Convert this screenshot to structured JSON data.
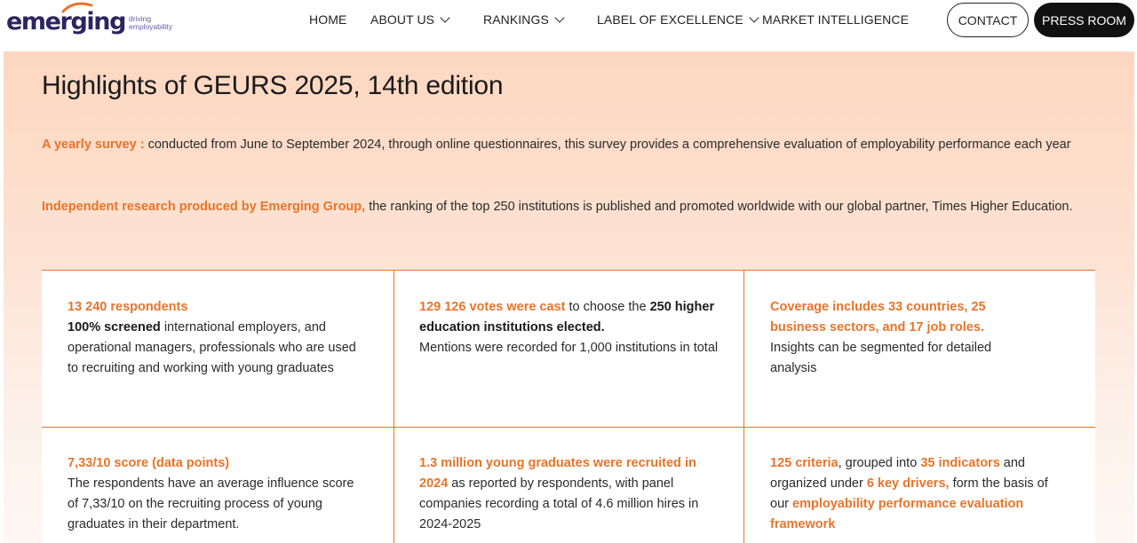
{
  "header": {
    "logo": {
      "word": "emerging",
      "tagline_line1": "driving",
      "tagline_line2": "employability"
    },
    "nav": {
      "home": "HOME",
      "about": "ABOUT US",
      "rankings": "RANKINGS",
      "label": "LABEL OF EXCELLENCE",
      "market": "MARKET INTELLIGENCE"
    },
    "contact": "CONTACT",
    "press": "PRESS ROOM"
  },
  "main": {
    "title": "Highlights of GEURS 2025, 14th edition",
    "para1": {
      "highlight": "A yearly survey :",
      "text": " conducted from June to September 2024, through online questionnaires, this survey provides a comprehensive evaluation of employability performance each year"
    },
    "para2": {
      "highlight": "Independent research produced by Emerging Group,",
      "text": " the ranking of the top 250 institutions is published and promoted worldwide with our global partner, Times Higher Education."
    },
    "cards": {
      "c1": {
        "o1": "13 240 respondents",
        "b1": "100% screened",
        "t1": " international employers, and operational managers, professionals who are used to recruiting and working with young graduates"
      },
      "c2": {
        "o1": "129 126 votes were cast",
        "t1": " to choose the ",
        "b1": "250 higher education institutions elected.",
        "t2": "Mentions were recorded for 1,000 institutions in total"
      },
      "c3": {
        "o1": "Coverage includes 33 countries, 25 business sectors, and 17 job roles.",
        "t1": "Insights can be segmented for detailed analysis"
      },
      "c4": {
        "o1": "7,33/10 score (data points)",
        "t1": "The respondents have an average influence score of 7,33/10 on the recruiting process of young graduates in their department."
      },
      "c5": {
        "o1": "1.3 million young graduates were recruited in 2024",
        "t1": " as reported by respondents, with panel companies recording a total of 4.6 million hires in 2024-2025"
      },
      "c6": {
        "o1": "125 criteria",
        "t1": ", grouped into ",
        "o2": "35 indicators",
        "t2": " and organized under ",
        "o3": "6 key drivers,",
        "t3": " form the basis of our ",
        "o4": "employability performance evaluation framework"
      }
    }
  },
  "colors": {
    "accent": "#e8742b",
    "brand": "#2b2560",
    "panel_bg": "#fdd7c0",
    "dark_button": "#111111"
  }
}
